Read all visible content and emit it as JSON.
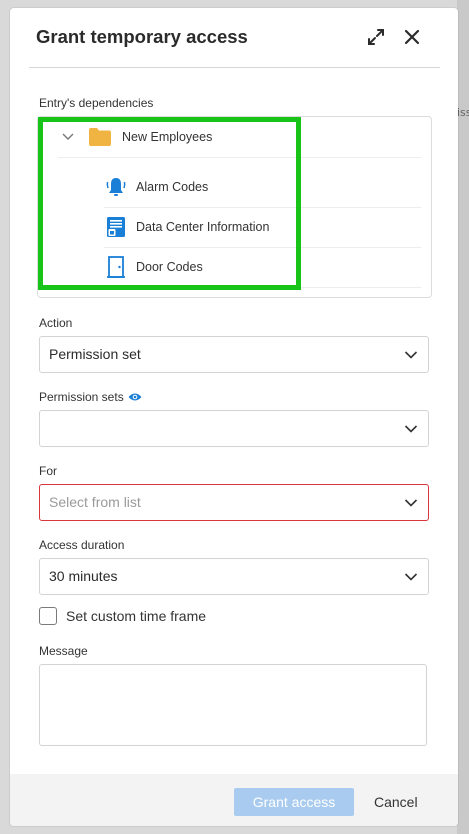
{
  "background": {
    "edge_text": "iss"
  },
  "dialog": {
    "title": "Grant temporary access",
    "expand_icon": "expand-icon",
    "close_icon": "close-icon"
  },
  "dependencies": {
    "label": "Entry's dependencies",
    "root": {
      "label": "New Employees",
      "icon": "folder-icon",
      "expanded": true
    },
    "children": [
      {
        "label": "Alarm Codes",
        "icon": "alarm-bell-icon"
      },
      {
        "label": "Data Center Information",
        "icon": "data-center-icon"
      },
      {
        "label": "Door Codes",
        "icon": "door-icon"
      }
    ]
  },
  "action": {
    "label": "Action",
    "value": "Permission set"
  },
  "permission_sets": {
    "label": "Permission sets",
    "value": ""
  },
  "for": {
    "label": "For",
    "placeholder": "Select from list"
  },
  "access_duration": {
    "label": "Access duration",
    "value": "30 minutes"
  },
  "custom_time_frame": {
    "label": "Set custom time frame",
    "checked": false
  },
  "message": {
    "label": "Message",
    "value": ""
  },
  "footer": {
    "grant_label": "Grant access",
    "cancel_label": "Cancel"
  },
  "colors": {
    "accent": "#1a7fd6",
    "highlight": "#17c417",
    "error_border": "#d9363e",
    "primary_disabled": "#a9cbef",
    "folder": "#f0b443"
  }
}
